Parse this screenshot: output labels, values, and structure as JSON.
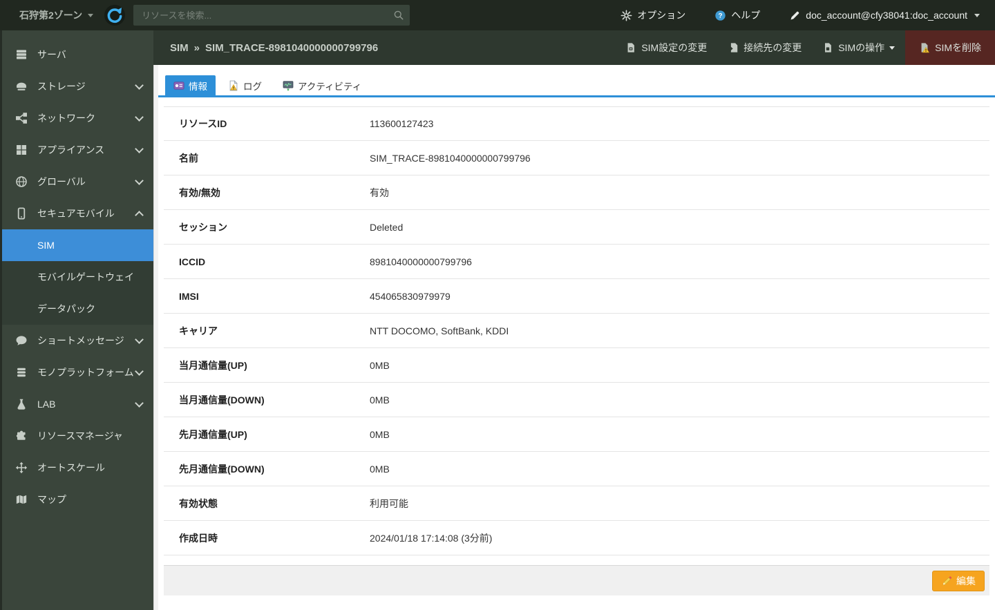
{
  "topbar": {
    "zone": "石狩第2ゾーン",
    "zone_icon": "globe-zone",
    "refresh_icon": "refresh",
    "search_placeholder": "リソースを検索...",
    "search_value": "",
    "search_icon": "search",
    "options": "オプション",
    "options_icon": "gear",
    "help": "ヘルプ",
    "help_icon": "help",
    "account": "doc_account@cfy38041:doc_account",
    "account_icon": "pen"
  },
  "sidebar": {
    "items": [
      {
        "id": "server",
        "label": "サーバ",
        "icon": "server",
        "sub": false,
        "active": false,
        "chev_down": false,
        "chev_up": false
      },
      {
        "id": "storage",
        "label": "ストレージ",
        "icon": "storage",
        "sub": false,
        "active": false,
        "chev_down": true,
        "chev_up": false
      },
      {
        "id": "network",
        "label": "ネットワーク",
        "icon": "network",
        "sub": false,
        "active": false,
        "chev_down": true,
        "chev_up": false
      },
      {
        "id": "appliance",
        "label": "アプライアンス",
        "icon": "appliance",
        "sub": false,
        "active": false,
        "chev_down": true,
        "chev_up": false
      },
      {
        "id": "global",
        "label": "グローバル",
        "icon": "global",
        "sub": false,
        "active": false,
        "chev_down": true,
        "chev_up": false
      },
      {
        "id": "secure-mobile",
        "label": "セキュアモバイル",
        "icon": "mobile",
        "sub": false,
        "active": false,
        "chev_down": false,
        "chev_up": true
      },
      {
        "id": "sim",
        "label": "SIM",
        "icon": "",
        "sub": true,
        "active": true,
        "chev_down": false,
        "chev_up": false
      },
      {
        "id": "mobile-gateway",
        "label": "モバイルゲートウェイ",
        "icon": "",
        "sub": true,
        "active": false,
        "chev_down": false,
        "chev_up": false
      },
      {
        "id": "data-pack",
        "label": "データパック",
        "icon": "",
        "sub": true,
        "active": false,
        "chev_down": false,
        "chev_up": false
      },
      {
        "id": "short-message",
        "label": "ショートメッセージ",
        "icon": "sms",
        "sub": false,
        "active": false,
        "chev_down": true,
        "chev_up": false
      },
      {
        "id": "mono-platform",
        "label": "モノプラットフォーム",
        "icon": "mono",
        "sub": false,
        "active": false,
        "chev_down": true,
        "chev_up": false
      },
      {
        "id": "lab",
        "label": "LAB",
        "icon": "lab",
        "sub": false,
        "active": false,
        "chev_down": true,
        "chev_up": false
      },
      {
        "id": "resource-manager",
        "label": "リソースマネージャ",
        "icon": "puzzle",
        "sub": false,
        "active": false,
        "chev_down": false,
        "chev_up": false
      },
      {
        "id": "autoscale",
        "label": "オートスケール",
        "icon": "autoscale",
        "sub": false,
        "active": false,
        "chev_down": false,
        "chev_up": false
      },
      {
        "id": "map",
        "label": "マップ",
        "icon": "map",
        "sub": false,
        "active": false,
        "chev_down": false,
        "chev_up": false
      }
    ]
  },
  "header": {
    "breadcrumb_section": "SIM",
    "breadcrumb_separator": "»",
    "breadcrumb_name": "SIM_TRACE-8981040000000799796",
    "actions": [
      {
        "id": "sim-settings",
        "label": "SIM設定の変更",
        "icon": "sim-settings",
        "caret": false,
        "danger": false
      },
      {
        "id": "connection-change",
        "label": "接続先の変更",
        "icon": "connect",
        "caret": false,
        "danger": false
      },
      {
        "id": "sim-operations",
        "label": "SIMの操作",
        "icon": "sim-card",
        "caret": true,
        "danger": false
      },
      {
        "id": "sim-delete",
        "label": "SIMを削除",
        "icon": "sim-delete",
        "caret": false,
        "danger": true
      }
    ]
  },
  "tabs": [
    {
      "id": "info",
      "label": "情報",
      "icon": "tab-info",
      "active": true
    },
    {
      "id": "log",
      "label": "ログ",
      "icon": "tab-log",
      "active": false
    },
    {
      "id": "activity",
      "label": "アクティビティ",
      "icon": "tab-activity",
      "active": false
    }
  ],
  "table": {
    "rows": [
      {
        "label": "リソースID",
        "value": "113600127423"
      },
      {
        "label": "名前",
        "value": "SIM_TRACE-8981040000000799796"
      },
      {
        "label": "有効/無効",
        "value": "有効"
      },
      {
        "label": "セッション",
        "value": "Deleted"
      },
      {
        "label": "ICCID",
        "value": "8981040000000799796"
      },
      {
        "label": "IMSI",
        "value": "454065830979979"
      },
      {
        "label": "キャリア",
        "value": "NTT DOCOMO, SoftBank, KDDI"
      },
      {
        "label": "当月通信量(UP)",
        "value": "0MB"
      },
      {
        "label": "当月通信量(DOWN)",
        "value": "0MB"
      },
      {
        "label": "先月通信量(UP)",
        "value": "0MB"
      },
      {
        "label": "先月通信量(DOWN)",
        "value": "0MB"
      },
      {
        "label": "有効状態",
        "value": "利用可能"
      },
      {
        "label": "作成日時",
        "value": "2024/01/18 17:14:08 (3分前)"
      }
    ]
  },
  "footer": {
    "edit_label": "編集",
    "edit_icon": "pencil"
  },
  "colors": {
    "topbar_bg": "#212820",
    "sidebar_bg": "#3a453b",
    "submenu_bg": "#323d34",
    "selected_blue": "#3d8ed8",
    "header_bg": "#2e382f",
    "danger_red": "#562622",
    "tab_blue": "#2d8fd8",
    "edit_orange": "#f6a41f"
  }
}
